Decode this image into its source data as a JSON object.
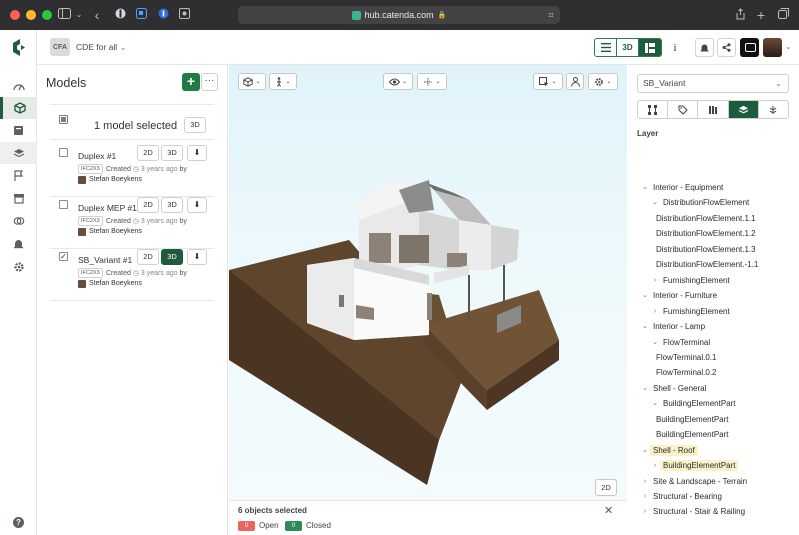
{
  "browser": {
    "url": "hub.catenda.com"
  },
  "app": {
    "project_badge": "CFA",
    "project_name": "CDE for all",
    "top_3d": "3D",
    "top_info": "i",
    "brand_color": "#1f5c3d"
  },
  "models": {
    "title": "Models",
    "add_label": "+",
    "more_label": "···",
    "selected_summary": "1 model selected",
    "selected_3d": "3D",
    "items": [
      {
        "name": "Duplex #1",
        "checked": false,
        "tag": "IFC2X3",
        "created_label": "Created",
        "ago": "3 years ago",
        "by": "by",
        "author": "Stefan Boeykens",
        "btn_2d": "2D",
        "btn_3d": "3D",
        "active_3d": false
      },
      {
        "name": "Duplex MEP #1",
        "checked": false,
        "tag": "IFC2X3",
        "created_label": "Created",
        "ago": "3 years ago",
        "by": "by",
        "author": "Stefan Boeykens",
        "btn_2d": "2D",
        "btn_3d": "3D",
        "active_3d": false
      },
      {
        "name": "SB_Variant #1",
        "checked": true,
        "tag": "IFC2X3",
        "created_label": "Created",
        "ago": "3 years ago",
        "by": "by",
        "author": "Stefan Boeykens",
        "btn_2d": "2D",
        "btn_3d": "3D",
        "active_3d": true
      }
    ]
  },
  "viewer": {
    "btn_2d": "2D",
    "footer_title": "6 objects selected",
    "open_count": "0",
    "open_label": "Open",
    "closed_count": "0",
    "closed_label": "Closed",
    "open_color": "#e8665c",
    "closed_color": "#2f8a55"
  },
  "layers": {
    "model_select": "SB_Variant",
    "section_title": "Layer",
    "tree": [
      {
        "label": "Interior - Equipment",
        "level": 0,
        "chevron": "v"
      },
      {
        "label": "DistributionFlowElement",
        "level": 1,
        "chevron": "v"
      },
      {
        "label": "DistributionFlowElement.1.1",
        "level": 2,
        "chevron": ""
      },
      {
        "label": "DistributionFlowElement.1.2",
        "level": 2,
        "chevron": ""
      },
      {
        "label": "DistributionFlowElement.1.3",
        "level": 2,
        "chevron": ""
      },
      {
        "label": "DistributionFlowElement.-1.1",
        "level": 2,
        "chevron": ""
      },
      {
        "label": "FurnishingElement",
        "level": 1,
        "chevron": ">"
      },
      {
        "label": "Interior - Furniture",
        "level": 0,
        "chevron": "v"
      },
      {
        "label": "FurnishingElement",
        "level": 1,
        "chevron": ">"
      },
      {
        "label": "Interior - Lamp",
        "level": 0,
        "chevron": "v"
      },
      {
        "label": "FlowTerminal",
        "level": 1,
        "chevron": "v"
      },
      {
        "label": "FlowTerminal.0.1",
        "level": 2,
        "chevron": ""
      },
      {
        "label": "FlowTerminal.0.2",
        "level": 2,
        "chevron": ""
      },
      {
        "label": "Shell - General",
        "level": 0,
        "chevron": "v"
      },
      {
        "label": "BuildingElementPart",
        "level": 1,
        "chevron": "v"
      },
      {
        "label": "BuildingElementPart",
        "level": 2,
        "chevron": ""
      },
      {
        "label": "BuildingElementPart",
        "level": 2,
        "chevron": ""
      },
      {
        "label": "Shell - Roof",
        "level": 0,
        "chevron": "v",
        "highlight": true
      },
      {
        "label": "BuildingElementPart",
        "level": 1,
        "chevron": ">",
        "highlight": true
      },
      {
        "label": "Site & Landscape - Terrain",
        "level": 0,
        "chevron": ">"
      },
      {
        "label": "Structural - Bearing",
        "level": 0,
        "chevron": ">"
      },
      {
        "label": "Structural - Stair & Railing",
        "level": 0,
        "chevron": ">"
      }
    ]
  }
}
